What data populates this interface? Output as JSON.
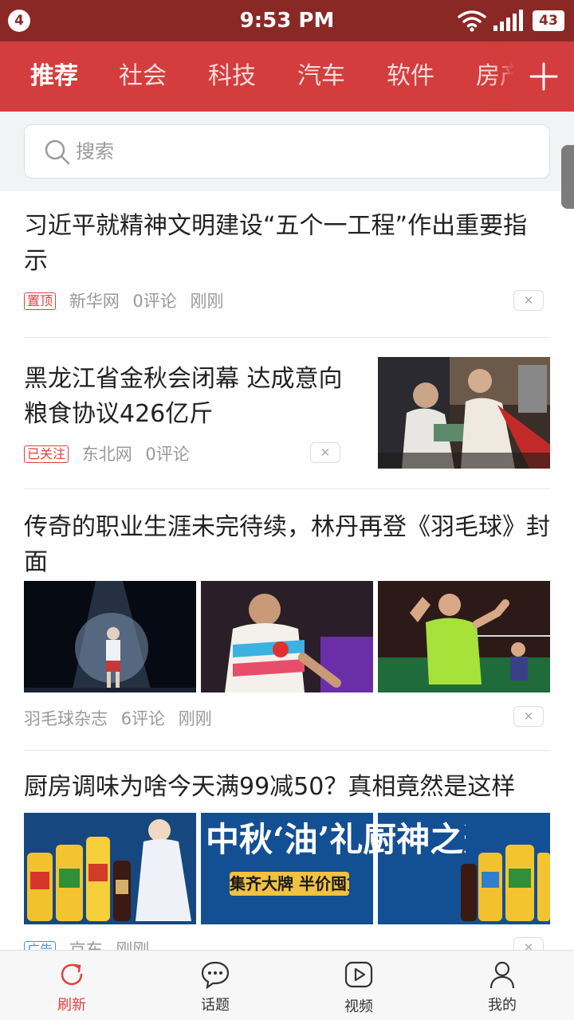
{
  "status_bar": {
    "notification_count": "4",
    "time": "9:53 PM",
    "battery": "43"
  },
  "tabs": [
    "推荐",
    "社会",
    "科技",
    "汽车",
    "软件",
    "房产"
  ],
  "search": {
    "placeholder": "搜索"
  },
  "articles": [
    {
      "title": "习近平就精神文明建设“五个一工程”作出重要指示",
      "tag": "置顶",
      "source": "新华网",
      "comments": "0评论",
      "time": "刚刚",
      "close": "✕"
    },
    {
      "title": "黑龙江省金秋会闭幕 达成意向粮食协议426亿斤",
      "tag": "已关注",
      "source": "东北网",
      "comments": "0评论",
      "close": "✕"
    },
    {
      "title": "传奇的职业生涯未完待续，林丹再登《羽毛球》封面",
      "source": "羽毛球杂志",
      "comments": "6评论",
      "time": "刚刚",
      "close": "✕"
    },
    {
      "title": "厨房调味为啥今天满99减50？真相竟然是这样",
      "tag": "广告",
      "source": "京东",
      "time": "刚刚",
      "close": "✕",
      "banner": {
        "headline": "中秋‘油’礼厨神之选",
        "subline": "集齐大牌 半价囤货"
      }
    }
  ],
  "bottom_nav": [
    {
      "label": "刷新",
      "icon": "refresh-icon",
      "active": true
    },
    {
      "label": "话题",
      "icon": "chat-bubble-icon"
    },
    {
      "label": "视频",
      "icon": "video-play-icon"
    },
    {
      "label": "我的",
      "icon": "user-icon"
    }
  ],
  "colors": {
    "status_bar": "#8a2826",
    "tab_bar": "#d43d3d",
    "accent": "#e04141",
    "ad_tag": "#4a90d9"
  }
}
